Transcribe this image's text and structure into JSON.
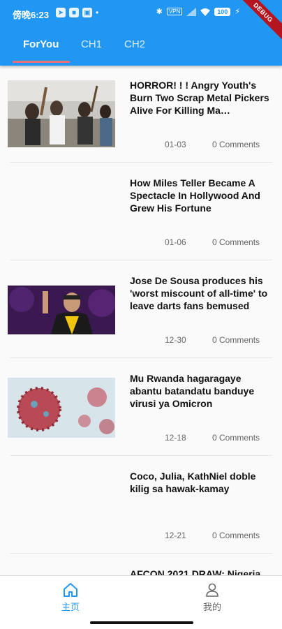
{
  "status_bar": {
    "time": "傍晚6:23",
    "battery": "100",
    "debug_label": "DEBUG",
    "vpn": "VPN"
  },
  "tabs": [
    {
      "label": "ForYou",
      "active": true
    },
    {
      "label": "CH1",
      "active": false
    },
    {
      "label": "CH2",
      "active": false
    }
  ],
  "feed": [
    {
      "title": "HORROR! ! ! Angry Youth's Burn Two Scrap Metal Pickers Alive For Killing Ma…",
      "date": "01-03",
      "comments": "0 Comments",
      "has_image": true,
      "image": "crowd-protest-photo"
    },
    {
      "title": "How Miles Teller Became A Spectacle In Hollywood And Grew His Fortune",
      "date": "01-06",
      "comments": "0 Comments",
      "has_image": false
    },
    {
      "title": "Jose De Sousa produces his 'worst miscount of all-time' to leave darts fans bemused",
      "date": "12-30",
      "comments": "0 Comments",
      "has_image": true,
      "image": "darts-player-photo"
    },
    {
      "title": "Mu Rwanda hagaragaye abantu batandatu banduye virusi ya Omicron",
      "date": "12-18",
      "comments": "0 Comments",
      "has_image": true,
      "image": "virus-illustration"
    },
    {
      "title": "Coco, Julia, KathNiel doble kilig sa hawak-kamay",
      "date": "12-21",
      "comments": "0 Comments",
      "has_image": false
    },
    {
      "title": "AFCON 2021 DRAW: Nigeria",
      "date": "",
      "comments": "",
      "has_image": false
    }
  ],
  "bottom_nav": [
    {
      "label": "主页",
      "icon": "home-icon",
      "active": true
    },
    {
      "label": "我的",
      "icon": "person-icon",
      "active": false
    }
  ],
  "colors": {
    "primary": "#2196f3",
    "indicator": "#e57373",
    "debug": "#b4151e"
  }
}
